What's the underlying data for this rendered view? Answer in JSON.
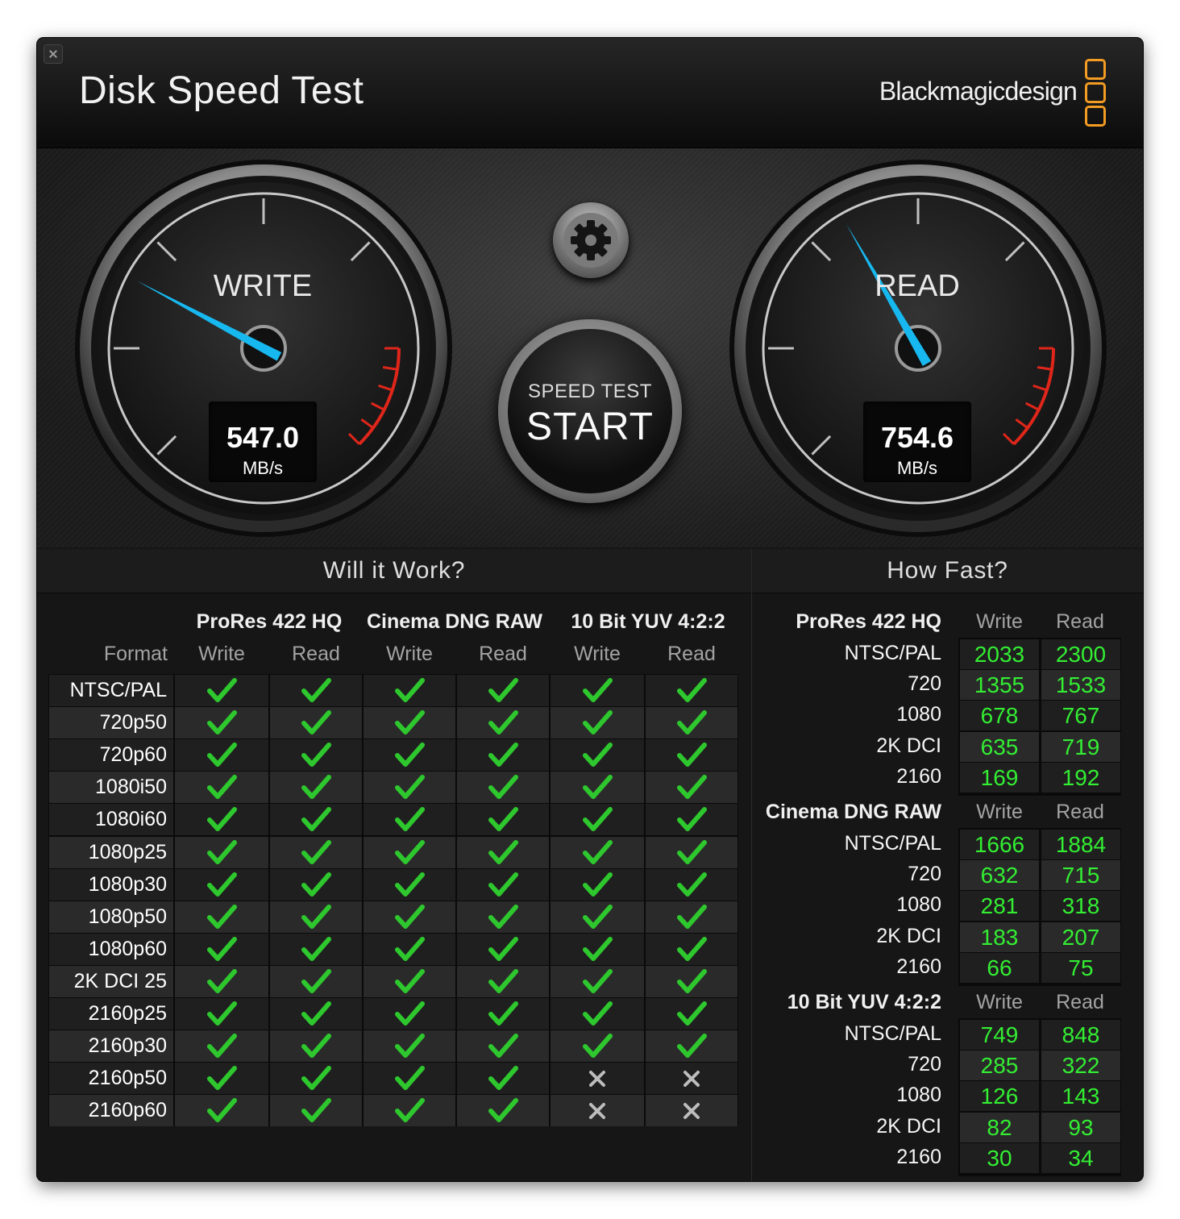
{
  "window": {
    "title": "Disk Speed Test",
    "brand": "Blackmagicdesign"
  },
  "colors": {
    "needle": "#17b8ef",
    "check": "#2ec82e",
    "number": "#33ee33",
    "logo": "#f39b22",
    "redzone": "#e0261a"
  },
  "gauges": {
    "write": {
      "label": "WRITE",
      "value": "547.0",
      "unit": "MB/s"
    },
    "read": {
      "label": "READ",
      "value": "754.6",
      "unit": "MB/s"
    }
  },
  "controls": {
    "settings_icon": "gear-icon",
    "start_sub": "SPEED TEST",
    "start_main": "START"
  },
  "will_it_work": {
    "title": "Will it Work?",
    "format_label": "Format",
    "groups": [
      "ProRes 422 HQ",
      "Cinema DNG RAW",
      "10 Bit YUV 4:2:2"
    ],
    "columns": [
      "Write",
      "Read",
      "Write",
      "Read",
      "Write",
      "Read"
    ],
    "rows": [
      {
        "format": "NTSC/PAL",
        "results": [
          1,
          1,
          1,
          1,
          1,
          1
        ]
      },
      {
        "format": "720p50",
        "results": [
          1,
          1,
          1,
          1,
          1,
          1
        ]
      },
      {
        "format": "720p60",
        "results": [
          1,
          1,
          1,
          1,
          1,
          1
        ]
      },
      {
        "format": "1080i50",
        "results": [
          1,
          1,
          1,
          1,
          1,
          1
        ]
      },
      {
        "format": "1080i60",
        "results": [
          1,
          1,
          1,
          1,
          1,
          1
        ]
      },
      {
        "format": "1080p25",
        "results": [
          1,
          1,
          1,
          1,
          1,
          1
        ]
      },
      {
        "format": "1080p30",
        "results": [
          1,
          1,
          1,
          1,
          1,
          1
        ]
      },
      {
        "format": "1080p50",
        "results": [
          1,
          1,
          1,
          1,
          1,
          1
        ]
      },
      {
        "format": "1080p60",
        "results": [
          1,
          1,
          1,
          1,
          1,
          1
        ]
      },
      {
        "format": "2K DCI 25",
        "results": [
          1,
          1,
          1,
          1,
          1,
          1
        ]
      },
      {
        "format": "2160p25",
        "results": [
          1,
          1,
          1,
          1,
          1,
          1
        ]
      },
      {
        "format": "2160p30",
        "results": [
          1,
          1,
          1,
          1,
          1,
          1
        ]
      },
      {
        "format": "2160p50",
        "results": [
          1,
          1,
          1,
          1,
          0,
          0
        ]
      },
      {
        "format": "2160p60",
        "results": [
          1,
          1,
          1,
          1,
          0,
          0
        ]
      }
    ]
  },
  "how_fast": {
    "title": "How Fast?",
    "groups": [
      {
        "name": "ProRes 422 HQ",
        "write_label": "Write",
        "read_label": "Read",
        "rows": [
          {
            "format": "NTSC/PAL",
            "write": "2033",
            "read": "2300"
          },
          {
            "format": "720",
            "write": "1355",
            "read": "1533"
          },
          {
            "format": "1080",
            "write": "678",
            "read": "767"
          },
          {
            "format": "2K DCI",
            "write": "635",
            "read": "719"
          },
          {
            "format": "2160",
            "write": "169",
            "read": "192"
          }
        ]
      },
      {
        "name": "Cinema DNG RAW",
        "write_label": "Write",
        "read_label": "Read",
        "rows": [
          {
            "format": "NTSC/PAL",
            "write": "1666",
            "read": "1884"
          },
          {
            "format": "720",
            "write": "632",
            "read": "715"
          },
          {
            "format": "1080",
            "write": "281",
            "read": "318"
          },
          {
            "format": "2K DCI",
            "write": "183",
            "read": "207"
          },
          {
            "format": "2160",
            "write": "66",
            "read": "75"
          }
        ]
      },
      {
        "name": "10 Bit YUV 4:2:2",
        "write_label": "Write",
        "read_label": "Read",
        "rows": [
          {
            "format": "NTSC/PAL",
            "write": "749",
            "read": "848"
          },
          {
            "format": "720",
            "write": "285",
            "read": "322"
          },
          {
            "format": "1080",
            "write": "126",
            "read": "143"
          },
          {
            "format": "2K DCI",
            "write": "82",
            "read": "93"
          },
          {
            "format": "2160",
            "write": "30",
            "read": "34"
          }
        ]
      }
    ]
  }
}
